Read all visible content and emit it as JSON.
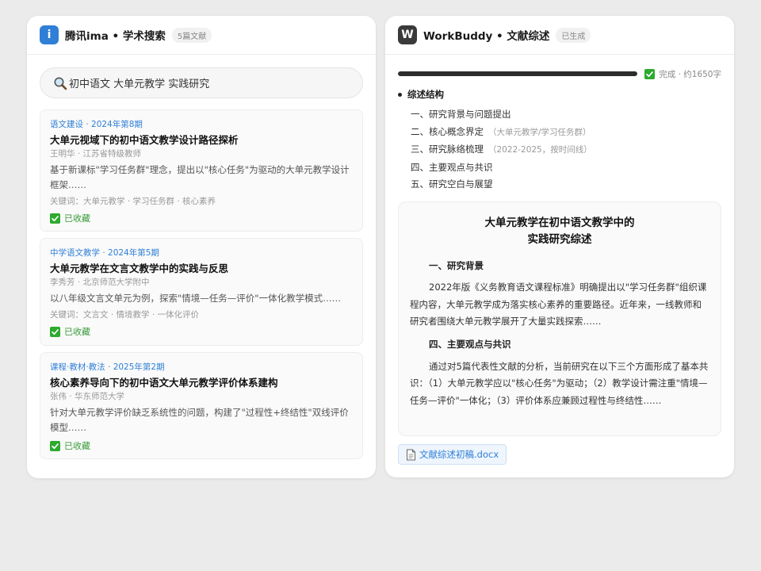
{
  "left_panel": {
    "app_icon_letter": "i",
    "app_icon_color": "#2f7fd6",
    "title": "腾讯ima • 学术搜索",
    "badge": "5篇文献",
    "search": {
      "value": "初中语文 大单元教学 实践研究",
      "icon": "search-icon"
    },
    "results": [
      {
        "source": "语文建设 · 2024年第8期",
        "title": "大单元视域下的初中语文教学设计路径探析",
        "author": "王明华 · 江苏省特级教师",
        "abstract": "基于新课标\"学习任务群\"理念，提出以\"核心任务\"为驱动的大单元教学设计框架……",
        "keywords": "关键词：大单元教学 · 学习任务群 · 核心素养",
        "status": "已收藏"
      },
      {
        "source": "中学语文教学 · 2024年第5期",
        "title": "大单元教学在文言文教学中的实践与反思",
        "author": "李秀芳 · 北京师范大学附中",
        "abstract": "以八年级文言文单元为例，探索\"情境—任务—评价\"一体化教学模式……",
        "keywords": "关键词：文言文 · 情境教学 · 一体化评价",
        "status": "已收藏"
      },
      {
        "source": "课程·教材·教法 · 2025年第2期",
        "title": "核心素养导向下的初中语文大单元教学评价体系建构",
        "author": "张伟 · 华东师范大学",
        "abstract": "针对大单元教学评价缺乏系统性的问题，构建了\"过程性+终结性\"双线评价模型……",
        "keywords": "",
        "status": "已收藏"
      }
    ]
  },
  "right_panel": {
    "app_icon_letter": "W",
    "app_icon_color": "#3a3a3a",
    "title": "WorkBuddy • 文献综述",
    "badge": "已生成",
    "progress": {
      "fraction": 1.0,
      "status": "完成 · 约1650字"
    },
    "outline": {
      "heading": "综述结构",
      "items": [
        {
          "label": "一、研究背景与问题提出",
          "note": ""
        },
        {
          "label": "二、核心概念界定",
          "note": "（大单元教学/学习任务群）"
        },
        {
          "label": "三、研究脉络梳理",
          "note": "（2022-2025，按时间线）"
        },
        {
          "label": "四、主要观点与共识",
          "note": ""
        },
        {
          "label": "五、研究空白与展望",
          "note": ""
        }
      ]
    },
    "document": {
      "title_line1": "大单元教学在初中语文教学中的",
      "title_line2": "实践研究综述",
      "section1_heading": "一、研究背景",
      "section1_text": "2022年版《义务教育语文课程标准》明确提出以\"学习任务群\"组织课程内容，大单元教学成为落实核心素养的重要路径。近年来，一线教师和研究者围绕大单元教学展开了大量实践探索……",
      "section4_heading": "四、主要观点与共识",
      "section4_text": "通过对5篇代表性文献的分析，当前研究在以下三个方面形成了基本共识：（1）大单元教学应以\"核心任务\"为驱动；（2）教学设计需注重\"情境—任务—评价\"一体化；（3）评价体系应兼顾过程性与终结性……"
    },
    "file": {
      "name": "文献综述初稿.docx",
      "icon": "document-icon"
    }
  },
  "colors": {
    "accent_blue": "#2f7fd6",
    "saved_green": "#3a9b3a",
    "check_bg": "#2eaa2e"
  }
}
